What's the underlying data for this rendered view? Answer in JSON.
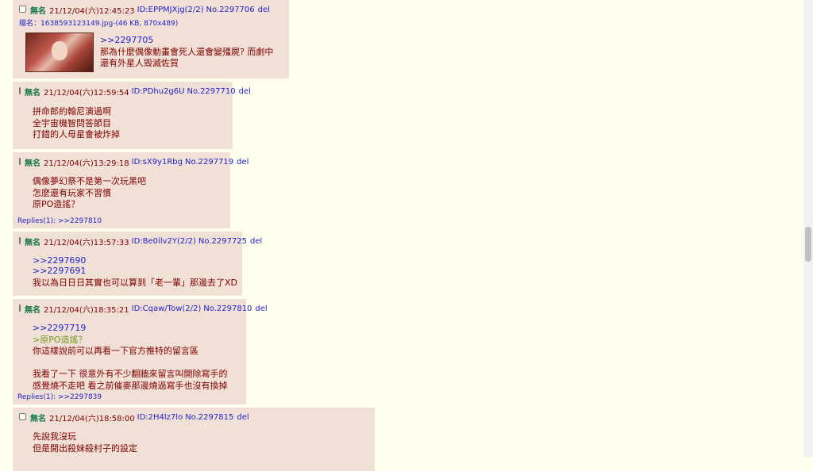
{
  "posts": [
    {
      "name": "無名",
      "date": "21/12/04(六)12:45:23",
      "id": "ID:EPPMJXjg(2/2)",
      "no": "No.2297706",
      "del": "del",
      "file": "檔名：1638593123149.jpg-(46 KB, 870x489)",
      "lines": [
        {
          "text": ">>2297705",
          "type": "quote"
        },
        {
          "text": "那為什麼偶像動畫會死人還會變殭屍? 而劇中",
          "type": "text"
        },
        {
          "text": "還有外星人毀滅佐賀",
          "type": "text"
        }
      ]
    },
    {
      "name": "無名",
      "date": "21/12/04(六)12:59:54",
      "id": "ID:PDhu2g6U",
      "no": "No.2297710",
      "del": "del",
      "lines": [
        {
          "text": "拼命郎約翰尼演過啊",
          "type": "text"
        },
        {
          "text": "全宇宙機智問答節目",
          "type": "text"
        },
        {
          "text": "打錯的人母星會被炸掉",
          "type": "text"
        }
      ]
    },
    {
      "name": "無名",
      "date": "21/12/04(六)13:29:18",
      "id": "ID:sX9y1Rbg",
      "no": "No.2297719",
      "del": "del",
      "lines": [
        {
          "text": "偶像夢幻祭不是第一次玩黑吧",
          "type": "text"
        },
        {
          "text": "怎麼還有玩家不習慣",
          "type": "text"
        },
        {
          "text": "原PO造謠？",
          "type": "text"
        }
      ],
      "replies": "Replies(1):  >>2297810"
    },
    {
      "name": "無名",
      "date": "21/12/04(六)13:57:33",
      "id": "ID:Be0ilv2Y(2/2)",
      "no": "No.2297725",
      "del": "del",
      "lines": [
        {
          "text": ">>2297690",
          "type": "quote"
        },
        {
          "text": ">>2297691",
          "type": "quote"
        },
        {
          "text": "我以為日日日其實也可以算到「老一輩」那邊去了XD",
          "type": "text"
        }
      ]
    },
    {
      "name": "無名",
      "date": "21/12/04(六)18:35:21",
      "id": "ID:Cqaw/Tow(2/2)",
      "no": "No.2297810",
      "del": "del",
      "lines": [
        {
          "text": ">>2297719",
          "type": "quote"
        },
        {
          "text": ">原PO造謠？",
          "type": "greentext"
        },
        {
          "text": "你這樣說前可以再看一下官方推特的留言區",
          "type": "text"
        },
        {
          "text": "",
          "type": "blank"
        },
        {
          "text": "我看了一下 很意外有不少翻牆來留言叫開除寫手的",
          "type": "text"
        },
        {
          "text": "感覺燒不走吧 看之前催麥那邊燒過寫手也沒有換掉",
          "type": "text"
        }
      ],
      "replies": "Replies(1):  >>2297839"
    },
    {
      "name": "無名",
      "date": "21/12/04(六)18:58:00",
      "id": "ID:2H4lz7lo",
      "no": "No.2297815",
      "del": "del",
      "lines": [
        {
          "text": "先說我沒玩",
          "type": "text"
        },
        {
          "text": "但是開出殺妹殺村子的設定",
          "type": "text"
        }
      ]
    }
  ]
}
